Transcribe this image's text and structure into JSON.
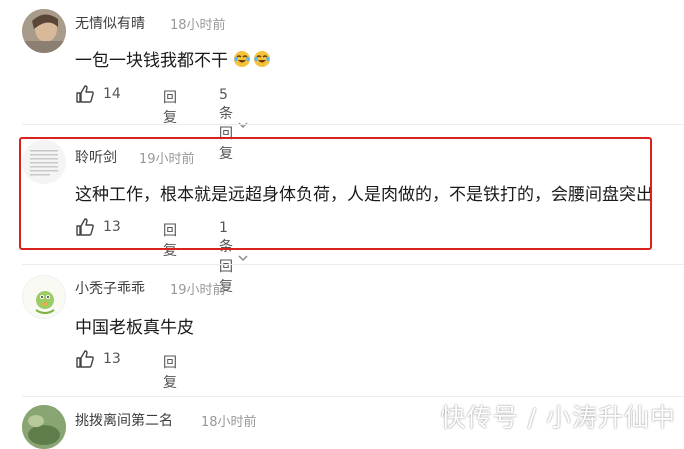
{
  "comments": [
    {
      "name": "无情似有晴",
      "time": "18小时前",
      "text": "一包一块钱我都不干",
      "likes": "14",
      "reply_label": "回复",
      "replies_label": "5条回复"
    },
    {
      "name": "聆听剑",
      "time": "19小时前",
      "text": "这种工作，根本就是远超身体负荷，人是肉做的，不是铁打的，会腰间盘突出",
      "likes": "13",
      "reply_label": "回复",
      "replies_label": "1条回复"
    },
    {
      "name": "小秃子乖乖",
      "time": "19小时前",
      "text": "中国老板真牛皮",
      "likes": "13",
      "reply_label": "回复"
    },
    {
      "name": "挑拨离间第二名",
      "time": "18小时前"
    }
  ],
  "watermark": "快传号 / 小涛升仙中",
  "colors": {
    "highlight": "#d9221c",
    "name": "#3d3d3d",
    "time": "#999999"
  },
  "icons": {
    "like": "thumbs-up-icon",
    "expand": "chevron-down-icon"
  }
}
